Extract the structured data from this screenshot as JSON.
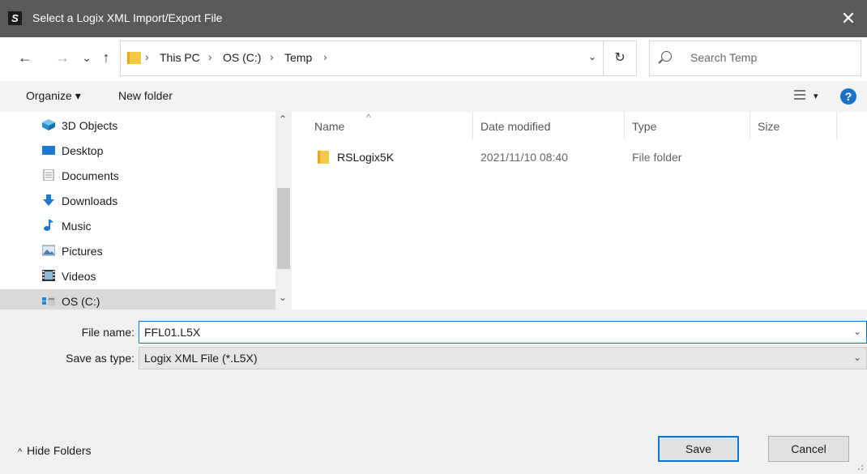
{
  "window": {
    "title": "Select a Logix XML Import/Export File",
    "app_icon_glyph": "S"
  },
  "navigation": {
    "back_glyph": "←",
    "forward_glyph": "→",
    "recent_glyph": "⌄",
    "up_glyph": "↑",
    "breadcrumbs": [
      "This PC",
      "OS (C:)",
      "Temp"
    ],
    "refresh_glyph": "↻",
    "search_placeholder": "Search Temp"
  },
  "toolbar": {
    "organize_label": "Organize ▾",
    "new_folder_label": "New folder",
    "help_glyph": "?"
  },
  "sidebar": {
    "items": [
      {
        "label": "3D Objects",
        "icon": "cube-icon"
      },
      {
        "label": "Desktop",
        "icon": "desktop-icon"
      },
      {
        "label": "Documents",
        "icon": "document-icon"
      },
      {
        "label": "Downloads",
        "icon": "download-icon"
      },
      {
        "label": "Music",
        "icon": "music-note-icon"
      },
      {
        "label": "Pictures",
        "icon": "picture-icon"
      },
      {
        "label": "Videos",
        "icon": "video-icon"
      },
      {
        "label": "OS (C:)",
        "icon": "drive-icon",
        "selected": true
      }
    ]
  },
  "file_list": {
    "columns": [
      "Name",
      "Date modified",
      "Type",
      "Size"
    ],
    "rows": [
      {
        "name": "RSLogix5K",
        "date_modified": "2021/11/10 08:40",
        "type": "File folder",
        "size": ""
      }
    ]
  },
  "form": {
    "file_name_label": "File name:",
    "file_name_value": "FFL01.L5X",
    "save_type_label": "Save as type:",
    "save_type_value": "Logix XML File (*.L5X)"
  },
  "footer": {
    "hide_folders_label": "Hide Folders",
    "save_label": "Save",
    "cancel_label": "Cancel"
  },
  "colors": {
    "titlebar": "#595959",
    "accent": "#0078d7",
    "selected": "#d9d9d9",
    "folder": "#f4c842"
  }
}
